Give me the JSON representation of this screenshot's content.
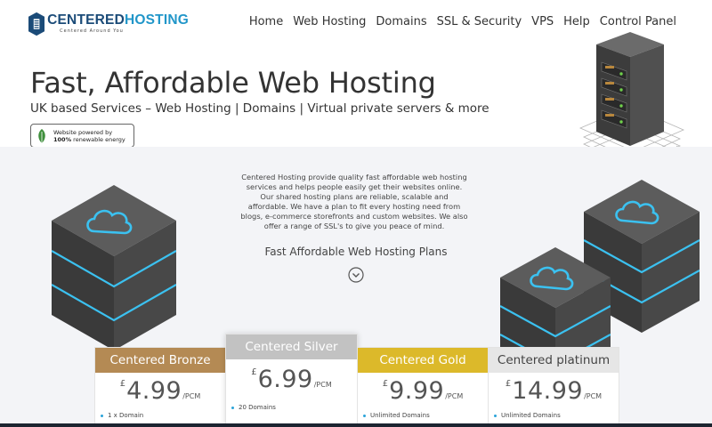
{
  "brand": {
    "name_part1": "CENTERED",
    "name_part2": "HOSTING",
    "tagline": "Centered Around You"
  },
  "nav": {
    "items": [
      "Home",
      "Web Hosting",
      "Domains",
      "SSL & Security",
      "VPS",
      "Help",
      "Control Panel"
    ]
  },
  "hero": {
    "title": "Fast, Affordable Web Hosting",
    "subtitle": "UK based Services – Web Hosting | Domains | Virtual private servers & more"
  },
  "eco_badge": {
    "line1": "Website powered by",
    "line2_bold": "100%",
    "line2_rest": " renewable energy"
  },
  "intro_text": "Centered Hosting provide quality fast affordable web hosting services and helps people easily get their websites online. Our shared hosting plans are reliable, scalable and affordable. We have a plan to fit every hosting need from blogs, e-commerce storefronts and custom websites. We also offer a range of SSL's to give you peace of mind.",
  "plans_section": {
    "title": "Fast Affordable Web Hosting Plans"
  },
  "plans": [
    {
      "name": "Centered Bronze",
      "currency": "£",
      "price": "4.99",
      "period": "/PCM",
      "color": "#b48a54",
      "feature": "1 x Domain"
    },
    {
      "name": "Centered Silver",
      "currency": "£",
      "price": "6.99",
      "period": "/PCM",
      "color": "#c2c2c2",
      "feature": "20 Domains"
    },
    {
      "name": "Centered Gold",
      "currency": "£",
      "price": "9.99",
      "period": "/PCM",
      "color": "#dcb92a",
      "feature": "Unlimited Domains"
    },
    {
      "name": "Centered platinum",
      "currency": "£",
      "price": "14.99",
      "period": "/PCM",
      "color": "#e6e6e6",
      "feature": "Unlimited Domains"
    }
  ],
  "colors": {
    "brand_dark": "#1b4b78",
    "brand_accent": "#2196c9",
    "cube_glow": "#3bc1f0",
    "band_bg": "#f3f4f7"
  }
}
